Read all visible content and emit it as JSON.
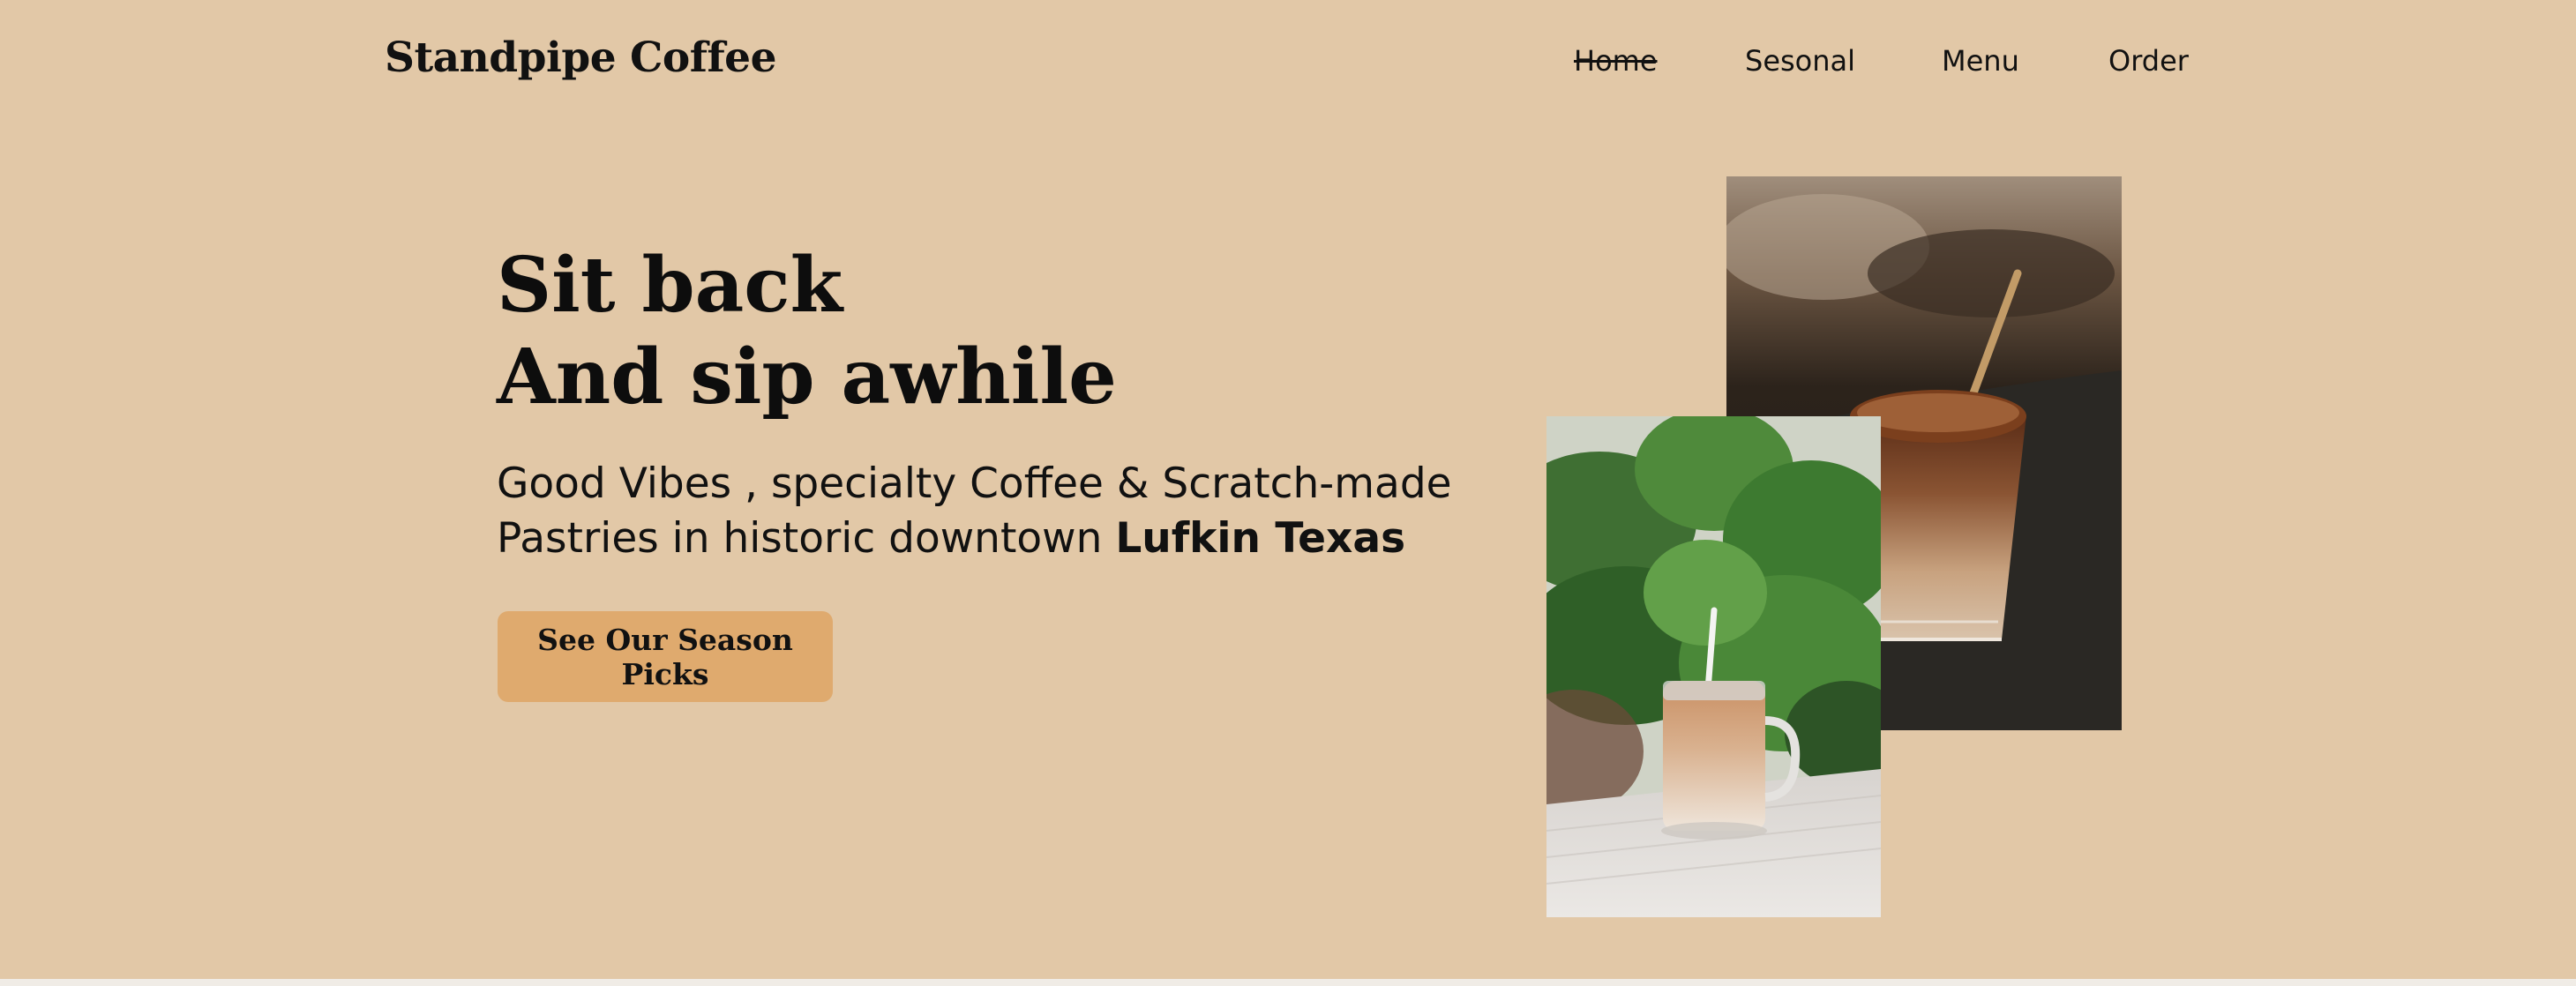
{
  "header": {
    "brand": "Standpipe Coffee",
    "nav": [
      {
        "label": "Home",
        "active": true
      },
      {
        "label": "Sesonal",
        "active": false
      },
      {
        "label": "Menu",
        "active": false
      },
      {
        "label": "Order",
        "active": false
      }
    ]
  },
  "hero": {
    "headline_line1": "Sit back",
    "headline_line2": "And sip awhile",
    "tagline_line1": "Good Vibes , specialty Coffee & Scratch-made",
    "tagline_line2_prefix": "Pastries in historic downtown ",
    "tagline_location": "Lufkin Texas",
    "cta_label": "See Our Season Picks"
  },
  "colors": {
    "background": "#e2c8a7",
    "cta": "#dfaa6e",
    "text": "#111111"
  }
}
